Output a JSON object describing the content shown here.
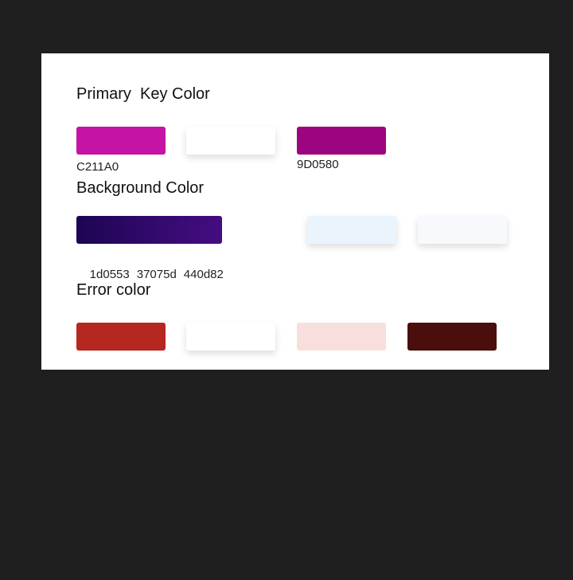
{
  "sections": {
    "primary": {
      "title": "Primary  Key Color",
      "swatches": [
        "#c413a5",
        "#ffffff",
        "#9d0580"
      ],
      "codes": [
        "C211A0",
        "9D0580"
      ]
    },
    "background": {
      "title": "Background Color",
      "gradient_colors": [
        "#1d0553",
        "#440d82"
      ],
      "swatches": [
        "#e9f4fd",
        "#f8f9fc"
      ],
      "codes": [
        "1d0553",
        "37075d",
        "440d82"
      ]
    },
    "error": {
      "title": "Error color",
      "swatches": [
        "#b52720",
        "#ffffff",
        "#f8dfdc",
        "#4a0e0c"
      ]
    }
  }
}
